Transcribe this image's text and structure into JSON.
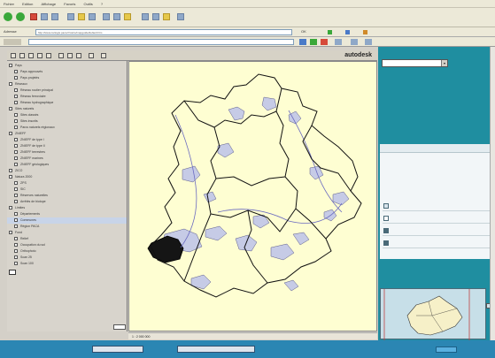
{
  "menu": [
    "Fichier",
    "Edition",
    "Affichage",
    "Favoris",
    "Outils",
    "?"
  ],
  "address": {
    "label": "Adresse",
    "value": "http://www.cartogis.paca.fr/carto/mapguide/default.htm",
    "go_label": "OK"
  },
  "map_toolbar": {
    "brand": "autodesk"
  },
  "layers": [
    {
      "label": "Pays"
    },
    {
      "label": "Pays approuvés"
    },
    {
      "label": "Pays projetés"
    },
    {
      "label": "Réseaux"
    },
    {
      "label": "Réseau routier principal"
    },
    {
      "label": "Réseau ferroviaire"
    },
    {
      "label": "Réseau hydrographique"
    },
    {
      "label": "Sites naturels"
    },
    {
      "label": "Sites classés"
    },
    {
      "label": "Sites inscrits"
    },
    {
      "label": "Parcs naturels régionaux"
    },
    {
      "label": "ZNIEFF"
    },
    {
      "label": "ZNIEFF de type I"
    },
    {
      "label": "ZNIEFF de type II"
    },
    {
      "label": "ZNIEFF terrestres"
    },
    {
      "label": "ZNIEFF marines"
    },
    {
      "label": "ZNIEFF géologiques"
    },
    {
      "label": "ZICO"
    },
    {
      "label": "Natura 2000"
    },
    {
      "label": "ZPS"
    },
    {
      "label": "SIC"
    },
    {
      "label": "Réserves naturelles"
    },
    {
      "label": "Arrêtés de biotope"
    },
    {
      "label": "Limites"
    },
    {
      "label": "Départements"
    },
    {
      "label": "Communes"
    },
    {
      "label": "Région PACA"
    },
    {
      "label": "Fond"
    },
    {
      "label": "Relief"
    },
    {
      "label": "Occupation du sol"
    },
    {
      "label": "Orthophoto"
    },
    {
      "label": "Scan 25"
    },
    {
      "label": "Scan 100"
    }
  ],
  "status": {
    "text": "1 : 2 000 000"
  },
  "panel": {
    "dropdown_value": "",
    "legend_title": "",
    "legend_desc": "",
    "legend_items": [
      {
        "label": "",
        "color": "#d8e4ec"
      },
      {
        "label": "",
        "color": "#ffffff"
      },
      {
        "label": "",
        "color": "#4a6a78"
      },
      {
        "label": "",
        "color": "#4a6a78"
      }
    ]
  },
  "bottom": {
    "left_text": "",
    "btn1": "",
    "btn2": ""
  },
  "colors": {
    "map_bg": "#fefed2",
    "panel_bg": "#1f8ea0",
    "bottom_bg": "#2b86b3",
    "zone_fill": "#c6cbe6",
    "dark_zone": "#151515"
  }
}
